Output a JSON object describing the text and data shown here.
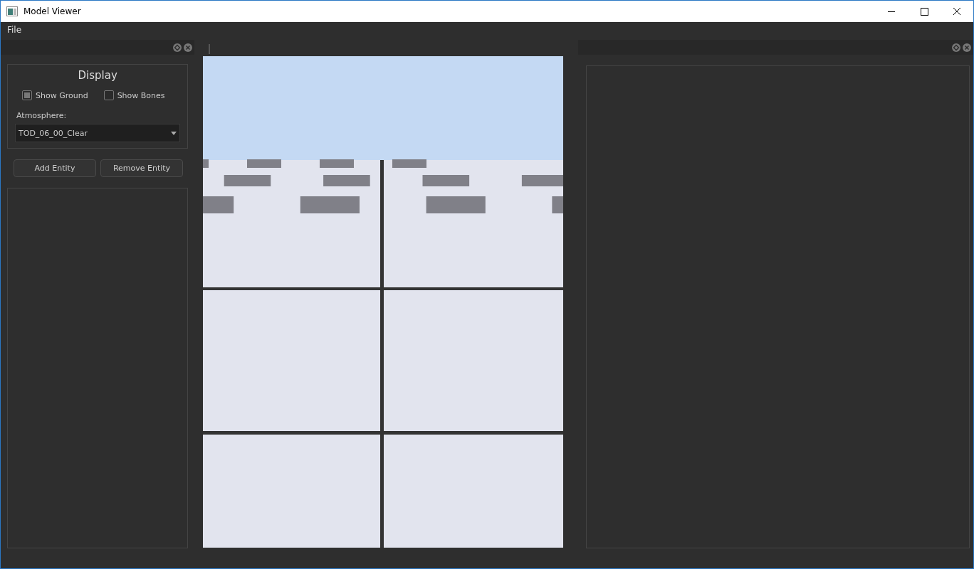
{
  "window": {
    "title": "Model Viewer"
  },
  "menu": [
    "File"
  ],
  "left_dock": {
    "display": {
      "title": "Display",
      "checkboxes": [
        {
          "label": "Show Ground",
          "checked": true
        },
        {
          "label": "Show Bones",
          "checked": false
        }
      ],
      "atmosphere": {
        "label": "Atmosphere:",
        "value": "TOD_06_00_Clear"
      }
    },
    "buttons": [
      "Add Entity",
      "Remove Entity"
    ]
  },
  "viewport": {
    "kind": "picture"
  }
}
